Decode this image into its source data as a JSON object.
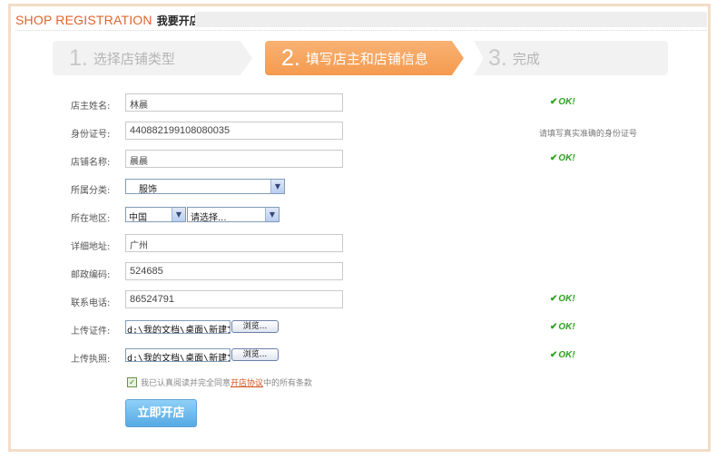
{
  "header": {
    "title_en": "SHOP REGISTRATION",
    "title_cn": "我要开店"
  },
  "steps": [
    {
      "num": "1.",
      "label": "选择店铺类型"
    },
    {
      "num": "2.",
      "label": "填写店主和店铺信息"
    },
    {
      "num": "3.",
      "label": "完成"
    }
  ],
  "form": {
    "owner_name": {
      "label": "店主姓名:",
      "value": "林晨",
      "status": "OK!"
    },
    "id_number": {
      "label": "身份证号:",
      "value": "440882199108080035",
      "hint": "请填写真实准确的身份证号"
    },
    "shop_name": {
      "label": "店铺名称:",
      "value": "晨晨",
      "status": "OK!"
    },
    "category": {
      "label": "所属分类:",
      "selected": "服饰"
    },
    "region": {
      "label": "所在地区:",
      "country": "中国",
      "province": "请选择..."
    },
    "address": {
      "label": "详细地址:",
      "value": "广州"
    },
    "postcode": {
      "label": "邮政编码:",
      "value": "524685"
    },
    "phone": {
      "label": "联系电话:",
      "value": "86524791",
      "status": "OK!"
    },
    "id_upload": {
      "label": "上传证件:",
      "path": "d:\\我的文档\\桌面\\新建文",
      "browse": "浏览...",
      "status": "OK!"
    },
    "license_upload": {
      "label": "上传执照:",
      "path": "d:\\我的文档\\桌面\\新建文",
      "browse": "浏览...",
      "status": "OK!"
    }
  },
  "agreement": {
    "prefix": "我已认真阅读并完全同意",
    "link": "开店协议",
    "suffix": "中的所有条款",
    "checked": true
  },
  "submit_label": "立即开店",
  "colors": {
    "accent": "#e0632a",
    "active_step": "#f49a4f",
    "ok": "#2ca21f",
    "button": "#55a9e4"
  }
}
